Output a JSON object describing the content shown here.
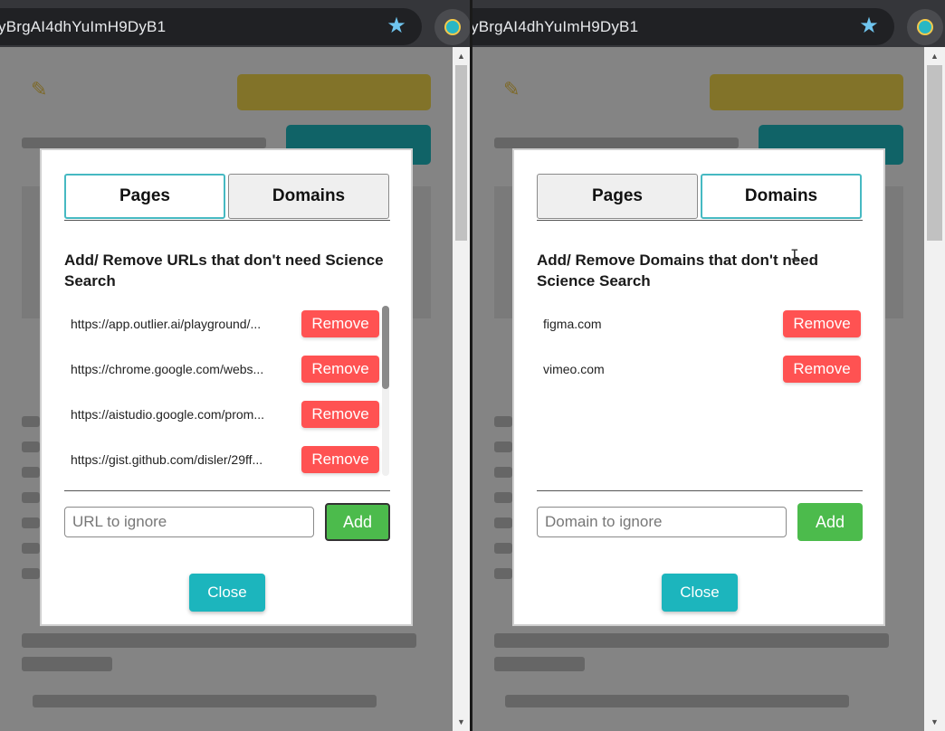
{
  "browser": {
    "url_fragment": "yBrgAI4dhYuImH9DyB1",
    "star_icon": "bookmark-star-icon",
    "extension_icon": "science-search-extension-icon"
  },
  "left": {
    "tabs": [
      {
        "label": "Pages",
        "active": true
      },
      {
        "label": "Domains",
        "active": false
      }
    ],
    "heading": "Add/ Remove URLs that don't need Science Search",
    "items": [
      {
        "url": "https://app.outlier.ai/playground/...",
        "remove_label": "Remove"
      },
      {
        "url": "https://chrome.google.com/webs...",
        "remove_label": "Remove"
      },
      {
        "url": "https://aistudio.google.com/prom...",
        "remove_label": "Remove"
      },
      {
        "url": "https://gist.github.com/disler/29ff...",
        "remove_label": "Remove"
      }
    ],
    "input_placeholder": "URL to ignore",
    "add_label": "Add",
    "close_label": "Close"
  },
  "right": {
    "tabs": [
      {
        "label": "Pages",
        "active": false
      },
      {
        "label": "Domains",
        "active": true
      }
    ],
    "heading": "Add/ Remove Domains that don't need Science Search",
    "items": [
      {
        "url": "figma.com",
        "remove_label": "Remove"
      },
      {
        "url": "vimeo.com",
        "remove_label": "Remove"
      }
    ],
    "input_placeholder": "Domain to ignore",
    "add_label": "Add",
    "close_label": "Close"
  },
  "colors": {
    "tab_active_border": "#46b9c2",
    "remove": "#ff5252",
    "add": "#4cbb4c",
    "close": "#1cb5bd",
    "star": "#6fc5ef"
  }
}
